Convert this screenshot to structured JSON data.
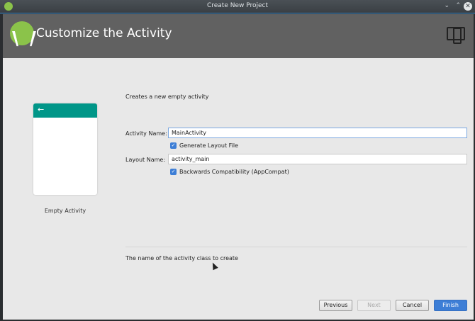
{
  "window": {
    "title": "Create New Project"
  },
  "header": {
    "title": "Customize the Activity"
  },
  "template": {
    "name": "Empty Activity",
    "back_arrow": "←"
  },
  "description": "Creates a new empty activity",
  "form": {
    "activity_name_label": "Activity Name:",
    "activity_name_value": "MainActivity",
    "generate_layout_label": "Generate Layout File",
    "generate_layout_checked": true,
    "layout_name_label": "Layout Name:",
    "layout_name_value": "activity_main",
    "backwards_compat_label": "Backwards Compatibility (AppCompat)",
    "backwards_compat_checked": true
  },
  "hint": "The name of the activity class to create",
  "buttons": {
    "previous": "Previous",
    "next": "Next",
    "cancel": "Cancel",
    "finish": "Finish"
  },
  "colors": {
    "accent": "#3d7ed6",
    "template_bar": "#009688",
    "header": "#616161"
  }
}
